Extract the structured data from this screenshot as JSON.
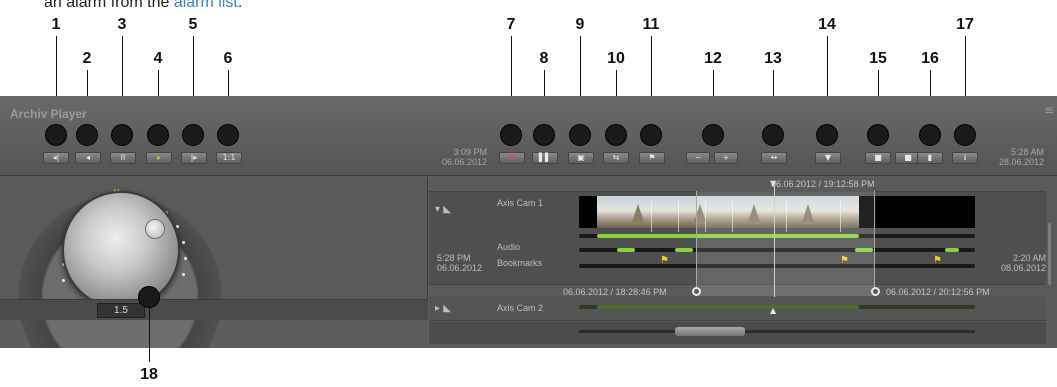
{
  "doc": {
    "caption_text": "an alarm from the ",
    "caption_link": "alarm list",
    "caption_end": "."
  },
  "callouts": [
    "1",
    "2",
    "3",
    "4",
    "5",
    "6",
    "7",
    "8",
    "9",
    "10",
    "11",
    "12",
    "13",
    "14",
    "15",
    "16",
    "17",
    "18"
  ],
  "player": {
    "title": "Archiv Player",
    "menu_glyph": "≡",
    "controls": {
      "prev_frame": "◂|",
      "step_back": "◂",
      "pause": "II",
      "play": "▸",
      "next_frame": "|▸",
      "speed_1to1": "1:1",
      "marker_in": "▼",
      "marker_out": "▌▌",
      "export": "▣",
      "loop": "⇆",
      "bookmark": "⚑",
      "zoom_out": "−",
      "zoom_in": "+",
      "fit": "↔",
      "location": "▼",
      "lock1": "■",
      "lock2": "■",
      "delete": "▮",
      "save": "⭳"
    },
    "start_time": "3:09 PM",
    "start_date": "06.06.2012",
    "end_time": "5:28 AM",
    "end_date": "28.06.2012"
  },
  "dial": {
    "speed_value": "1.5",
    "pause_mark": "II"
  },
  "timeline": {
    "marker_time": "06.06.2012 / 19:12:58 PM",
    "cameras": [
      {
        "name": "Axis Cam 1"
      },
      {
        "name": "Axis Cam 2"
      }
    ],
    "audio_label": "Audio",
    "bookmarks_label": "Bookmarks",
    "left_time": "5:28 PM",
    "left_date": "06.06.2012",
    "right_time": "2:20 AM",
    "right_date": "08.06.2012",
    "range_start": "06.06.2012 / 18:28:46 PM",
    "range_end": "06.06.2012 / 20:12:56 PM"
  },
  "colors": {
    "panel": "#5d5d5d",
    "accent_green": "#8bd13a",
    "flag_yellow": "#f2d020",
    "callout_bubble": "#1a1a1a",
    "link_blue": "#3b7fc4"
  }
}
